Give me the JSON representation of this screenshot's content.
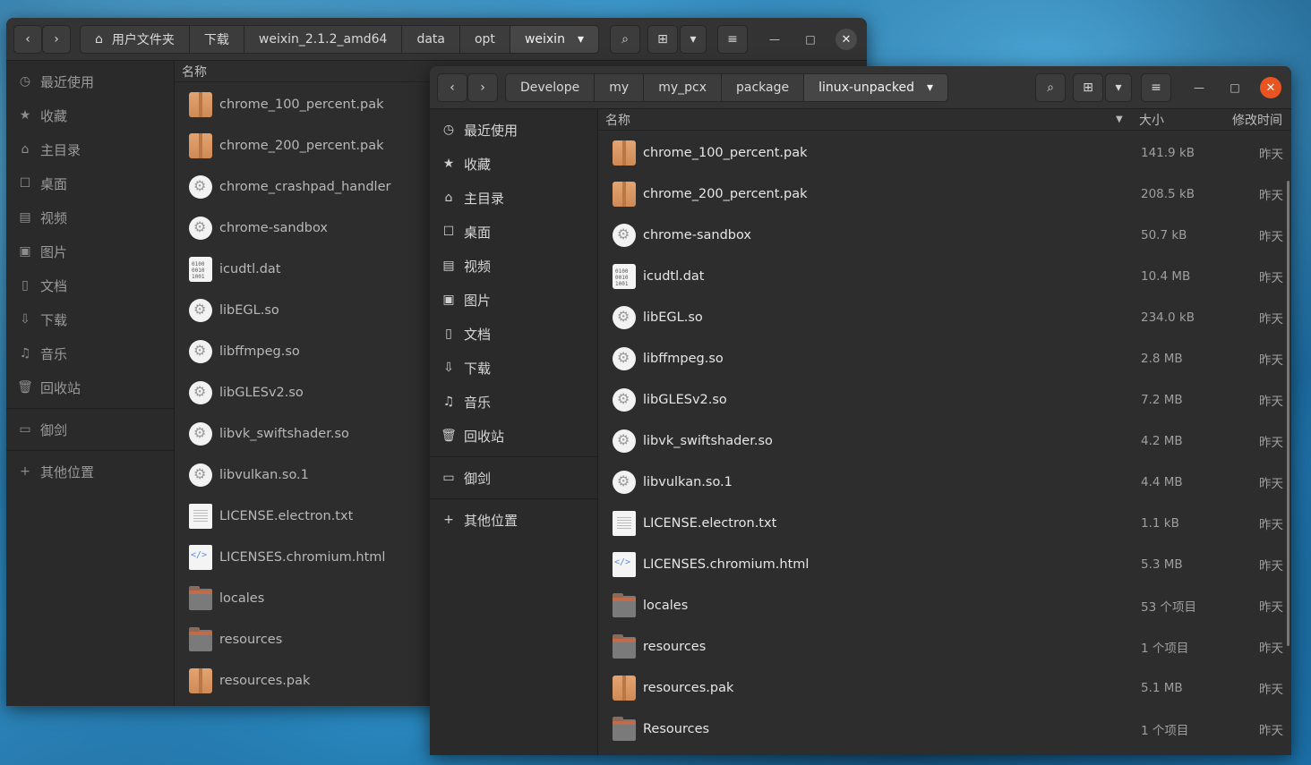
{
  "sidebar": [
    {
      "icon": "clock-icon",
      "glyph": "◷",
      "label": "最近使用"
    },
    {
      "icon": "star-icon",
      "glyph": "★",
      "label": "收藏"
    },
    {
      "icon": "home-icon",
      "glyph": "⌂",
      "label": "主目录"
    },
    {
      "icon": "desktop-icon",
      "glyph": "☐",
      "label": "桌面"
    },
    {
      "icon": "video-icon",
      "glyph": "▤",
      "label": "视频"
    },
    {
      "icon": "picture-icon",
      "glyph": "▣",
      "label": "图片"
    },
    {
      "icon": "document-icon",
      "glyph": "▯",
      "label": "文档"
    },
    {
      "icon": "download-icon",
      "glyph": "⇩",
      "label": "下载"
    },
    {
      "icon": "music-icon",
      "glyph": "♫",
      "label": "音乐"
    },
    {
      "icon": "trash-icon",
      "glyph": "🗑",
      "label": "回收站"
    },
    {
      "icon": "folder-icon",
      "glyph": "▭",
      "label": "御剑"
    },
    {
      "icon": "plus-icon",
      "glyph": "+",
      "label": "其他位置"
    }
  ],
  "window1": {
    "path": [
      "用户文件夹",
      "下载",
      "weixin_2.1.2_amd64",
      "data",
      "opt",
      "weixin"
    ],
    "column_name": "名称",
    "files": [
      {
        "name": "chrome_100_percent.pak",
        "type": "pak"
      },
      {
        "name": "chrome_200_percent.pak",
        "type": "pak"
      },
      {
        "name": "chrome_crashpad_handler",
        "type": "exe"
      },
      {
        "name": "chrome-sandbox",
        "type": "exe"
      },
      {
        "name": "icudtl.dat",
        "type": "dat"
      },
      {
        "name": "libEGL.so",
        "type": "exe"
      },
      {
        "name": "libffmpeg.so",
        "type": "exe"
      },
      {
        "name": "libGLESv2.so",
        "type": "exe"
      },
      {
        "name": "libvk_swiftshader.so",
        "type": "exe"
      },
      {
        "name": "libvulkan.so.1",
        "type": "exe"
      },
      {
        "name": "LICENSE.electron.txt",
        "type": "txt"
      },
      {
        "name": "LICENSES.chromium.html",
        "type": "html"
      },
      {
        "name": "locales",
        "type": "dir"
      },
      {
        "name": "resources",
        "type": "dir"
      },
      {
        "name": "resources.pak",
        "type": "pak"
      }
    ]
  },
  "window2": {
    "path": [
      "Develope",
      "my",
      "my_pcx",
      "package",
      "linux-unpacked"
    ],
    "column_name": "名称",
    "column_size": "大小",
    "column_modified": "修改时间",
    "files": [
      {
        "name": "chrome_100_percent.pak",
        "type": "pak",
        "size": "141.9 kB",
        "modified": "昨天"
      },
      {
        "name": "chrome_200_percent.pak",
        "type": "pak",
        "size": "208.5 kB",
        "modified": "昨天"
      },
      {
        "name": "chrome-sandbox",
        "type": "exe",
        "size": "50.7 kB",
        "modified": "昨天"
      },
      {
        "name": "icudtl.dat",
        "type": "dat",
        "size": "10.4 MB",
        "modified": "昨天"
      },
      {
        "name": "libEGL.so",
        "type": "exe",
        "size": "234.0 kB",
        "modified": "昨天"
      },
      {
        "name": "libffmpeg.so",
        "type": "exe",
        "size": "2.8 MB",
        "modified": "昨天"
      },
      {
        "name": "libGLESv2.so",
        "type": "exe",
        "size": "7.2 MB",
        "modified": "昨天"
      },
      {
        "name": "libvk_swiftshader.so",
        "type": "exe",
        "size": "4.2 MB",
        "modified": "昨天"
      },
      {
        "name": "libvulkan.so.1",
        "type": "exe",
        "size": "4.4 MB",
        "modified": "昨天"
      },
      {
        "name": "LICENSE.electron.txt",
        "type": "txt",
        "size": "1.1 kB",
        "modified": "昨天"
      },
      {
        "name": "LICENSES.chromium.html",
        "type": "html",
        "size": "5.3 MB",
        "modified": "昨天"
      },
      {
        "name": "locales",
        "type": "dir",
        "size": "53 个项目",
        "modified": "昨天"
      },
      {
        "name": "resources",
        "type": "dir",
        "size": "1 个项目",
        "modified": "昨天"
      },
      {
        "name": "resources.pak",
        "type": "pak",
        "size": "5.1 MB",
        "modified": "昨天"
      },
      {
        "name": "Resources",
        "type": "dir",
        "size": "1 个项目",
        "modified": "昨天"
      }
    ]
  }
}
